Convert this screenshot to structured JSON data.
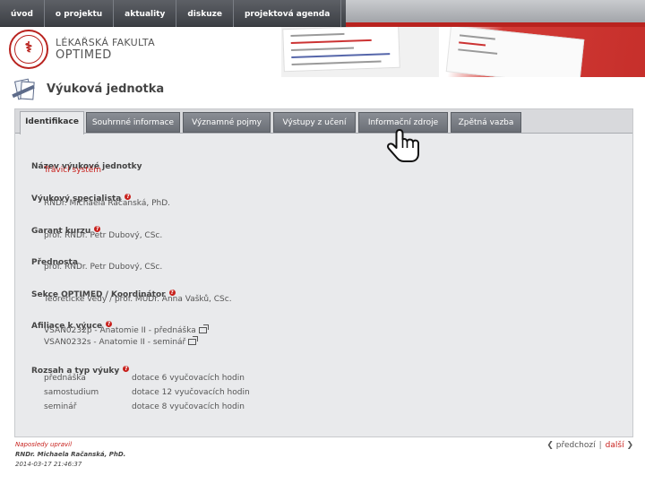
{
  "nav": {
    "items": [
      "úvod",
      "o projektu",
      "aktuality",
      "diskuze",
      "projektová agenda"
    ]
  },
  "header": {
    "faculty": "LÉKAŘSKÁ FAKULTA",
    "project": "OPTIMED"
  },
  "page": {
    "title": "Výuková jednotka"
  },
  "tabs": [
    {
      "label": "Identifikace",
      "active": true
    },
    {
      "label": "Souhrnné informace",
      "active": false
    },
    {
      "label": "Významné pojmy",
      "active": false
    },
    {
      "label": "Výstupy z učení",
      "active": false
    },
    {
      "label": "Informační zdroje",
      "active": false
    },
    {
      "label": "Zpětná vazba",
      "active": false
    }
  ],
  "identification": {
    "unit_name_label": "Název výukové jednotky",
    "unit_name_value": "Trávicí systém",
    "specialist_label": "Výukový specialista",
    "specialist_value": "RNDr. Michaela Račanská, PhD.",
    "guarantor_label": "Garant kurzu",
    "guarantor_value": "prof. RNDr. Petr Dubový, CSc.",
    "head_label": "Přednosta",
    "head_value": "prof. RNDr. Petr Dubový, CSc.",
    "section_label": "Sekce OPTIMED / Koordinátor",
    "section_value": "Teoretické vědy / prof. MUDr. Anna Vašků, CSc.",
    "affiliation_label": "Afiliace k výuce",
    "affiliations": [
      "VSAN0232p - Anatomie II - přednáška",
      "VSAN0232s - Anatomie II - seminář"
    ],
    "scope_label": "Rozsah a typ výuky",
    "scope": [
      {
        "type": "přednáška",
        "amount": "dotace 6 vyučovacích hodin"
      },
      {
        "type": "samostudium",
        "amount": "dotace 12 vyučovacích hodin"
      },
      {
        "type": "seminář",
        "amount": "dotace 8 vyučovacích hodin"
      }
    ]
  },
  "footer": {
    "last_update_label": "Naposledy upravil",
    "last_update_name": "RNDr. Michaela Račanská, PhD.",
    "last_update_date": "2014-03-17 21:46:37",
    "prev": "předchozí",
    "next": "další"
  },
  "colors": {
    "accent_red": "#c8211d",
    "nav_dark": "#4a4d52",
    "tab_gray": "#7a7e85"
  }
}
